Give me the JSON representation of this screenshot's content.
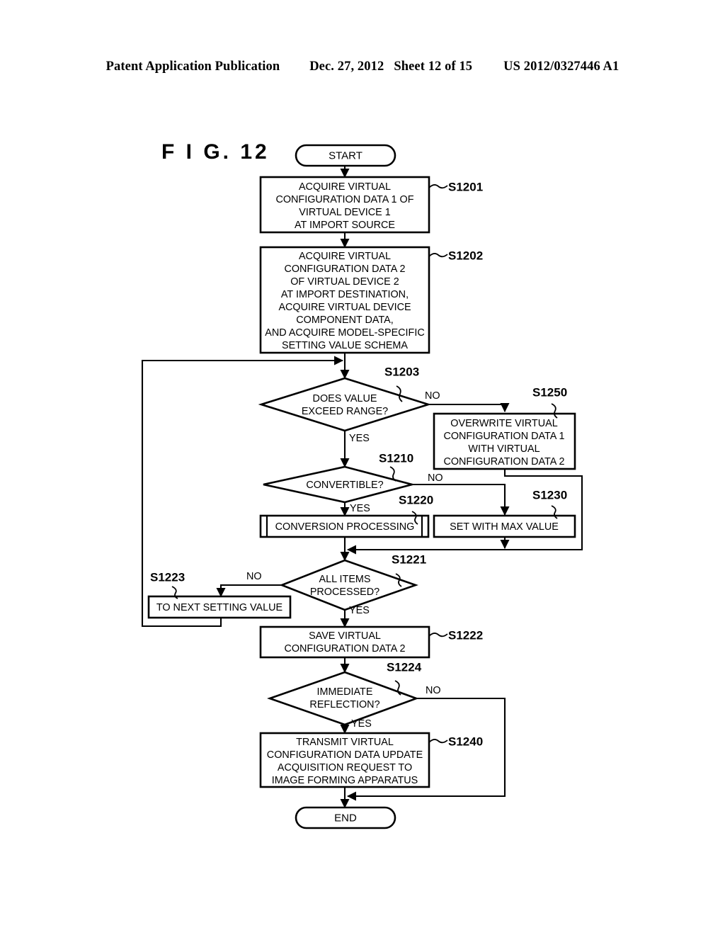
{
  "header": {
    "publication": "Patent Application Publication",
    "date": "Dec. 27, 2012",
    "sheet": "Sheet 12 of 15",
    "document_number": "US 2012/0327446 A1"
  },
  "figure": {
    "label": "F I G.  12"
  },
  "flowchart": {
    "terminators": {
      "start": "START",
      "end": "END"
    },
    "branch_labels": {
      "yes": "YES",
      "no": "NO"
    },
    "nodes": [
      {
        "id": "S1201",
        "type": "process",
        "lines": [
          "ACQUIRE VIRTUAL",
          "CONFIGURATION DATA 1 OF",
          "VIRTUAL DEVICE 1",
          "AT IMPORT SOURCE"
        ]
      },
      {
        "id": "S1202",
        "type": "process",
        "lines": [
          "ACQUIRE VIRTUAL",
          "CONFIGURATION DATA 2",
          "OF VIRTUAL DEVICE 2",
          "AT IMPORT DESTINATION,",
          "ACQUIRE VIRTUAL DEVICE",
          "COMPONENT DATA,",
          "AND ACQUIRE MODEL-SPECIFIC",
          "SETTING VALUE SCHEMA"
        ]
      },
      {
        "id": "S1203",
        "type": "decision",
        "lines": [
          "DOES VALUE",
          "EXCEED RANGE?"
        ],
        "yes": "YES",
        "no": "NO"
      },
      {
        "id": "S1250",
        "type": "process",
        "lines": [
          "OVERWRITE VIRTUAL",
          "CONFIGURATION DATA 1",
          "WITH VIRTUAL",
          "CONFIGURATION DATA 2"
        ]
      },
      {
        "id": "S1210",
        "type": "decision",
        "lines": [
          "CONVERTIBLE?"
        ],
        "yes": "YES",
        "no": "NO"
      },
      {
        "id": "S1220",
        "type": "predefined-process",
        "lines": [
          "CONVERSION PROCESSING"
        ]
      },
      {
        "id": "S1230",
        "type": "process",
        "lines": [
          "SET WITH MAX VALUE"
        ]
      },
      {
        "id": "S1221",
        "type": "decision",
        "lines": [
          "ALL ITEMS",
          "PROCESSED?"
        ],
        "yes": "YES",
        "no": "NO"
      },
      {
        "id": "S1223",
        "type": "process",
        "lines": [
          "TO NEXT SETTING VALUE"
        ]
      },
      {
        "id": "S1222",
        "type": "process",
        "lines": [
          "SAVE VIRTUAL",
          "CONFIGURATION DATA 2"
        ]
      },
      {
        "id": "S1224",
        "type": "decision",
        "lines": [
          "IMMEDIATE",
          "REFLECTION?"
        ],
        "yes": "YES",
        "no": "NO"
      },
      {
        "id": "S1240",
        "type": "process",
        "lines": [
          "TRANSMIT VIRTUAL",
          "CONFIGURATION DATA UPDATE",
          "ACQUISITION REQUEST TO",
          "IMAGE FORMING APPARATUS"
        ]
      }
    ]
  }
}
